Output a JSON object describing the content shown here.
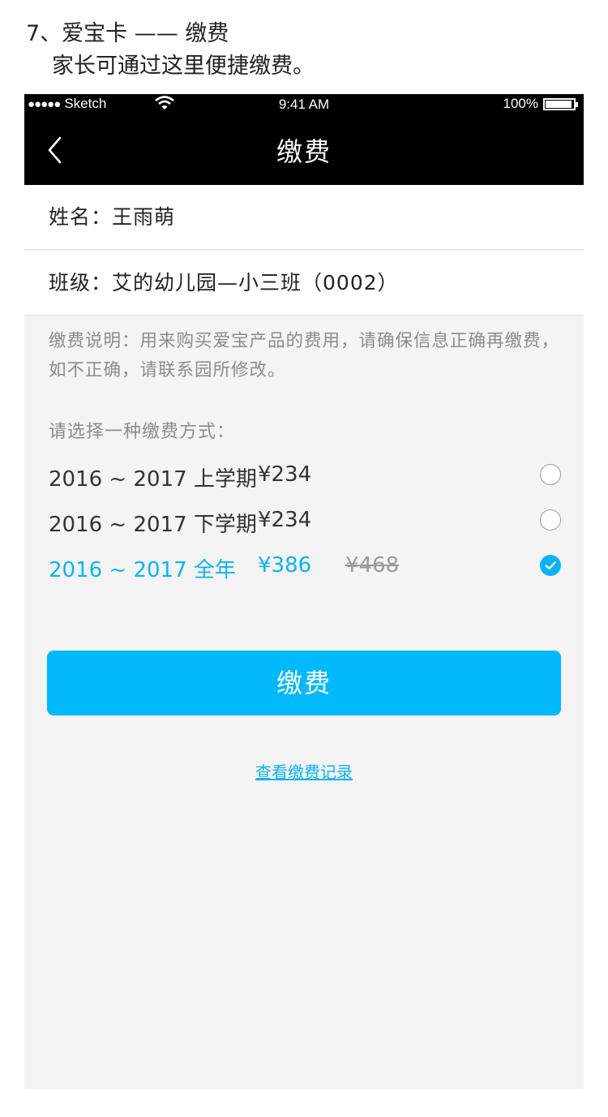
{
  "annotation": {
    "title": "7、爱宝卡 —— 缴费",
    "subtitle": "家长可通过这里便捷缴费。"
  },
  "statusbar": {
    "signal": "●●●●●",
    "carrier": "Sketch",
    "time": "9:41 AM",
    "battery": "100%",
    "battery_level": 1.0
  },
  "navbar": {
    "back_icon": "chevron-left-icon",
    "title": "缴费"
  },
  "profile": {
    "name_row": "姓名：王雨萌",
    "class_row": "班级：艾的幼儿园—小三班（0002）"
  },
  "description": "缴费说明：用来购买爱宝产品的费用，请确保信息正确再缴费，如不正确，请联系园所修改。",
  "payment": {
    "prompt": "请选择一种缴费方式：",
    "options": [
      {
        "period": "2016 ~ 2017 上学期",
        "price": "¥234",
        "original_price": "",
        "selected": false
      },
      {
        "period": "2016 ~ 2017 下学期",
        "price": "¥234",
        "original_price": "",
        "selected": false
      },
      {
        "period": "2016 ~ 2017 全年",
        "price": "¥386",
        "original_price": "¥468",
        "selected": true
      }
    ],
    "button_label": "缴费",
    "records_link": "查看缴费记录"
  },
  "colors": {
    "accent": "#0eb2f2",
    "button": "#00b8fa",
    "navbar": "#000000",
    "background": "#f4f4f4"
  }
}
